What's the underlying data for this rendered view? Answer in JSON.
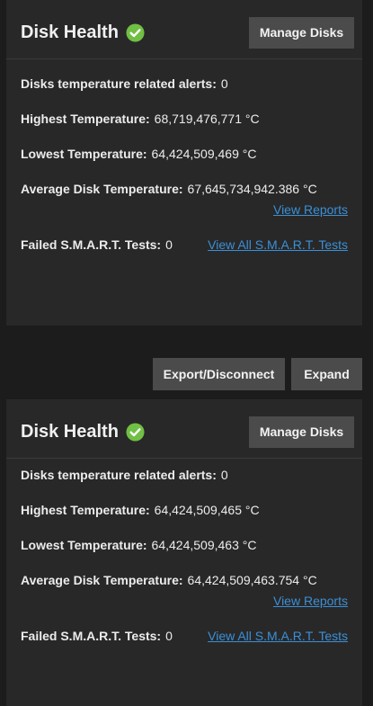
{
  "colors": {
    "background": "#1c1c1c",
    "card": "#282828",
    "button": "#4b4b4b",
    "link": "#3b8fd6",
    "ok_green": "#71bf44"
  },
  "pool_top": {
    "title": "Disk Health",
    "status_icon": "check-circle-icon",
    "manage_disks_label": "Manage Disks",
    "alerts_label": "Disks temperature related alerts:",
    "alerts_value": "0",
    "highest_label": "Highest Temperature:",
    "highest_value": "68,719,476,771 °C",
    "lowest_label": "Lowest Temperature:",
    "lowest_value": "64,424,509,469 °C",
    "average_label": "Average Disk Temperature:",
    "average_value": "67,645,734,942.386 °C",
    "view_reports_label": "View Reports",
    "failed_smart_label": "Failed S.M.A.R.T. Tests:",
    "failed_smart_value": "0",
    "view_all_smart_label": "View All S.M.A.R.T. Tests"
  },
  "toolbar": {
    "export_disconnect_label": "Export/Disconnect",
    "expand_label": "Expand"
  },
  "pool_bottom": {
    "title": "Disk Health",
    "status_icon": "check-circle-icon",
    "manage_disks_label": "Manage Disks",
    "alerts_label": "Disks temperature related alerts:",
    "alerts_value": "0",
    "highest_label": "Highest Temperature:",
    "highest_value": "64,424,509,465 °C",
    "lowest_label": "Lowest Temperature:",
    "lowest_value": "64,424,509,463 °C",
    "average_label": "Average Disk Temperature:",
    "average_value": "64,424,509,463.754 °C",
    "view_reports_label": "View Reports",
    "failed_smart_label": "Failed S.M.A.R.T. Tests:",
    "failed_smart_value": "0",
    "view_all_smart_label": "View All S.M.A.R.T. Tests"
  }
}
